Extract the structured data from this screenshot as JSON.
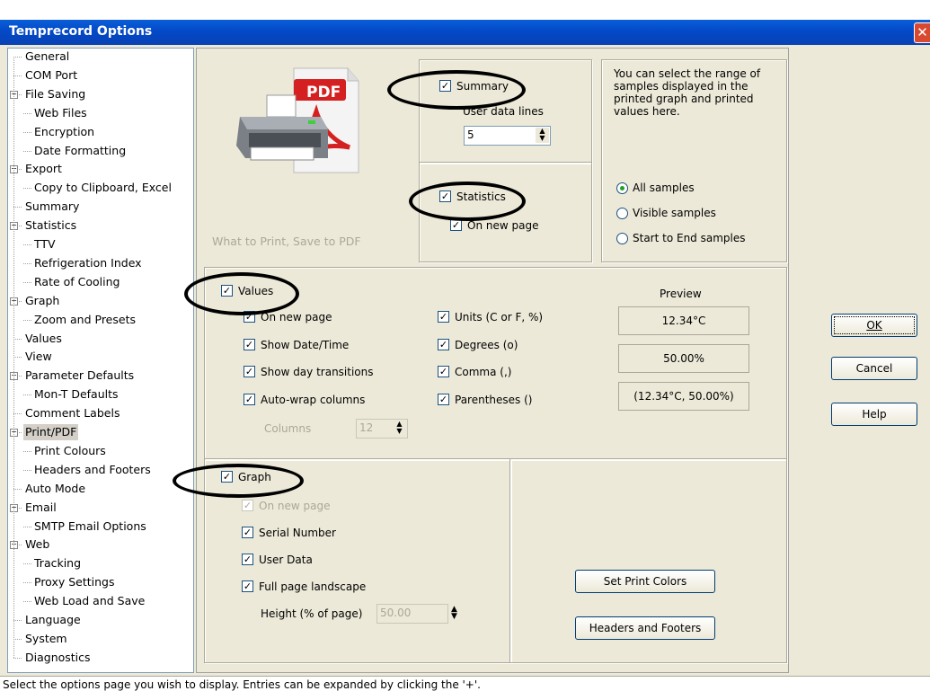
{
  "window": {
    "title": "Temprecord Options",
    "close_symbol": "✕"
  },
  "tree": {
    "items": [
      {
        "label": "General",
        "level": 0
      },
      {
        "label": "COM Port",
        "level": 0
      },
      {
        "label": "File Saving",
        "level": 0,
        "expanded": true
      },
      {
        "label": "Web Files",
        "level": 1
      },
      {
        "label": "Encryption",
        "level": 1
      },
      {
        "label": "Date Formatting",
        "level": 1
      },
      {
        "label": "Export",
        "level": 0,
        "expanded": true
      },
      {
        "label": "Copy to Clipboard, Excel",
        "level": 1
      },
      {
        "label": "Summary",
        "level": 0
      },
      {
        "label": "Statistics",
        "level": 0,
        "expanded": true
      },
      {
        "label": "TTV",
        "level": 1
      },
      {
        "label": "Refrigeration Index",
        "level": 1
      },
      {
        "label": "Rate of Cooling",
        "level": 1
      },
      {
        "label": "Graph",
        "level": 0,
        "expanded": true
      },
      {
        "label": "Zoom and Presets",
        "level": 1
      },
      {
        "label": "Values",
        "level": 0
      },
      {
        "label": "View",
        "level": 0
      },
      {
        "label": "Parameter Defaults",
        "level": 0,
        "expanded": true
      },
      {
        "label": "Mon-T Defaults",
        "level": 1
      },
      {
        "label": "Comment Labels",
        "level": 0
      },
      {
        "label": "Print/PDF",
        "level": 0,
        "expanded": true,
        "selected": true
      },
      {
        "label": "Print Colours",
        "level": 1
      },
      {
        "label": "Headers and Footers",
        "level": 1
      },
      {
        "label": "Auto Mode",
        "level": 0
      },
      {
        "label": "Email",
        "level": 0,
        "expanded": true
      },
      {
        "label": "SMTP Email Options",
        "level": 1
      },
      {
        "label": "Web",
        "level": 0,
        "expanded": true
      },
      {
        "label": "Tracking",
        "level": 1
      },
      {
        "label": "Proxy Settings",
        "level": 1
      },
      {
        "label": "Web Load and Save",
        "level": 1
      },
      {
        "label": "Language",
        "level": 0
      },
      {
        "label": "System",
        "level": 0
      },
      {
        "label": "Diagnostics",
        "level": 0
      }
    ]
  },
  "print_icon": {
    "badge": "PDF"
  },
  "what_to_print": "What to Print, Save to PDF",
  "summary": {
    "label": "Summary",
    "checked": true,
    "user_data_lines_label": "User data lines",
    "user_data_lines_value": "5"
  },
  "statistics": {
    "label": "Statistics",
    "checked": true,
    "on_new_page_label": "On new page",
    "on_new_page_checked": true
  },
  "range": {
    "description": "You can select the range of samples displayed in the printed graph and printed values here.",
    "options": [
      {
        "label": "All samples",
        "selected": true
      },
      {
        "label": "Visible samples",
        "selected": false
      },
      {
        "label": "Start to End samples",
        "selected": false
      }
    ]
  },
  "values": {
    "label": "Values",
    "checked": true,
    "left_options": [
      {
        "label": "On new page",
        "checked": true
      },
      {
        "label": "Show Date/Time",
        "checked": true
      },
      {
        "label": "Show day transitions",
        "checked": true
      },
      {
        "label": "Auto-wrap columns",
        "checked": true
      }
    ],
    "right_options": [
      {
        "label": "Units (C or F, %)",
        "checked": true
      },
      {
        "label": "Degrees (o)",
        "checked": true
      },
      {
        "label": "Comma (,)",
        "checked": true
      },
      {
        "label": "Parentheses ()",
        "checked": true
      }
    ],
    "columns_label": "Columns",
    "columns_value": "12",
    "preview_label": "Preview",
    "preview_values": [
      "12.34°C",
      "50.00%",
      "(12.34°C, 50.00%)"
    ]
  },
  "graph": {
    "label": "Graph",
    "checked": true,
    "options": [
      {
        "label": "On new page",
        "checked": true,
        "disabled": true
      },
      {
        "label": "Serial Number",
        "checked": true,
        "disabled": false
      },
      {
        "label": "User Data",
        "checked": true,
        "disabled": false
      },
      {
        "label": "Full page landscape",
        "checked": true,
        "disabled": false
      }
    ],
    "height_label": "Height (% of page)",
    "height_value": "50.00"
  },
  "buttons": {
    "set_print_colors": "Set Print Colors",
    "headers_and_footers": "Headers and Footers",
    "ok": "OK",
    "cancel": "Cancel",
    "help": "Help"
  },
  "status_text": "Select the options page you wish to display.  Entries can be expanded by clicking the '+'.",
  "check_mark": "✓",
  "colors": {
    "title_bar": "#0a5fd8",
    "face": "#ece9d8",
    "pdf_red": "#d42020"
  }
}
